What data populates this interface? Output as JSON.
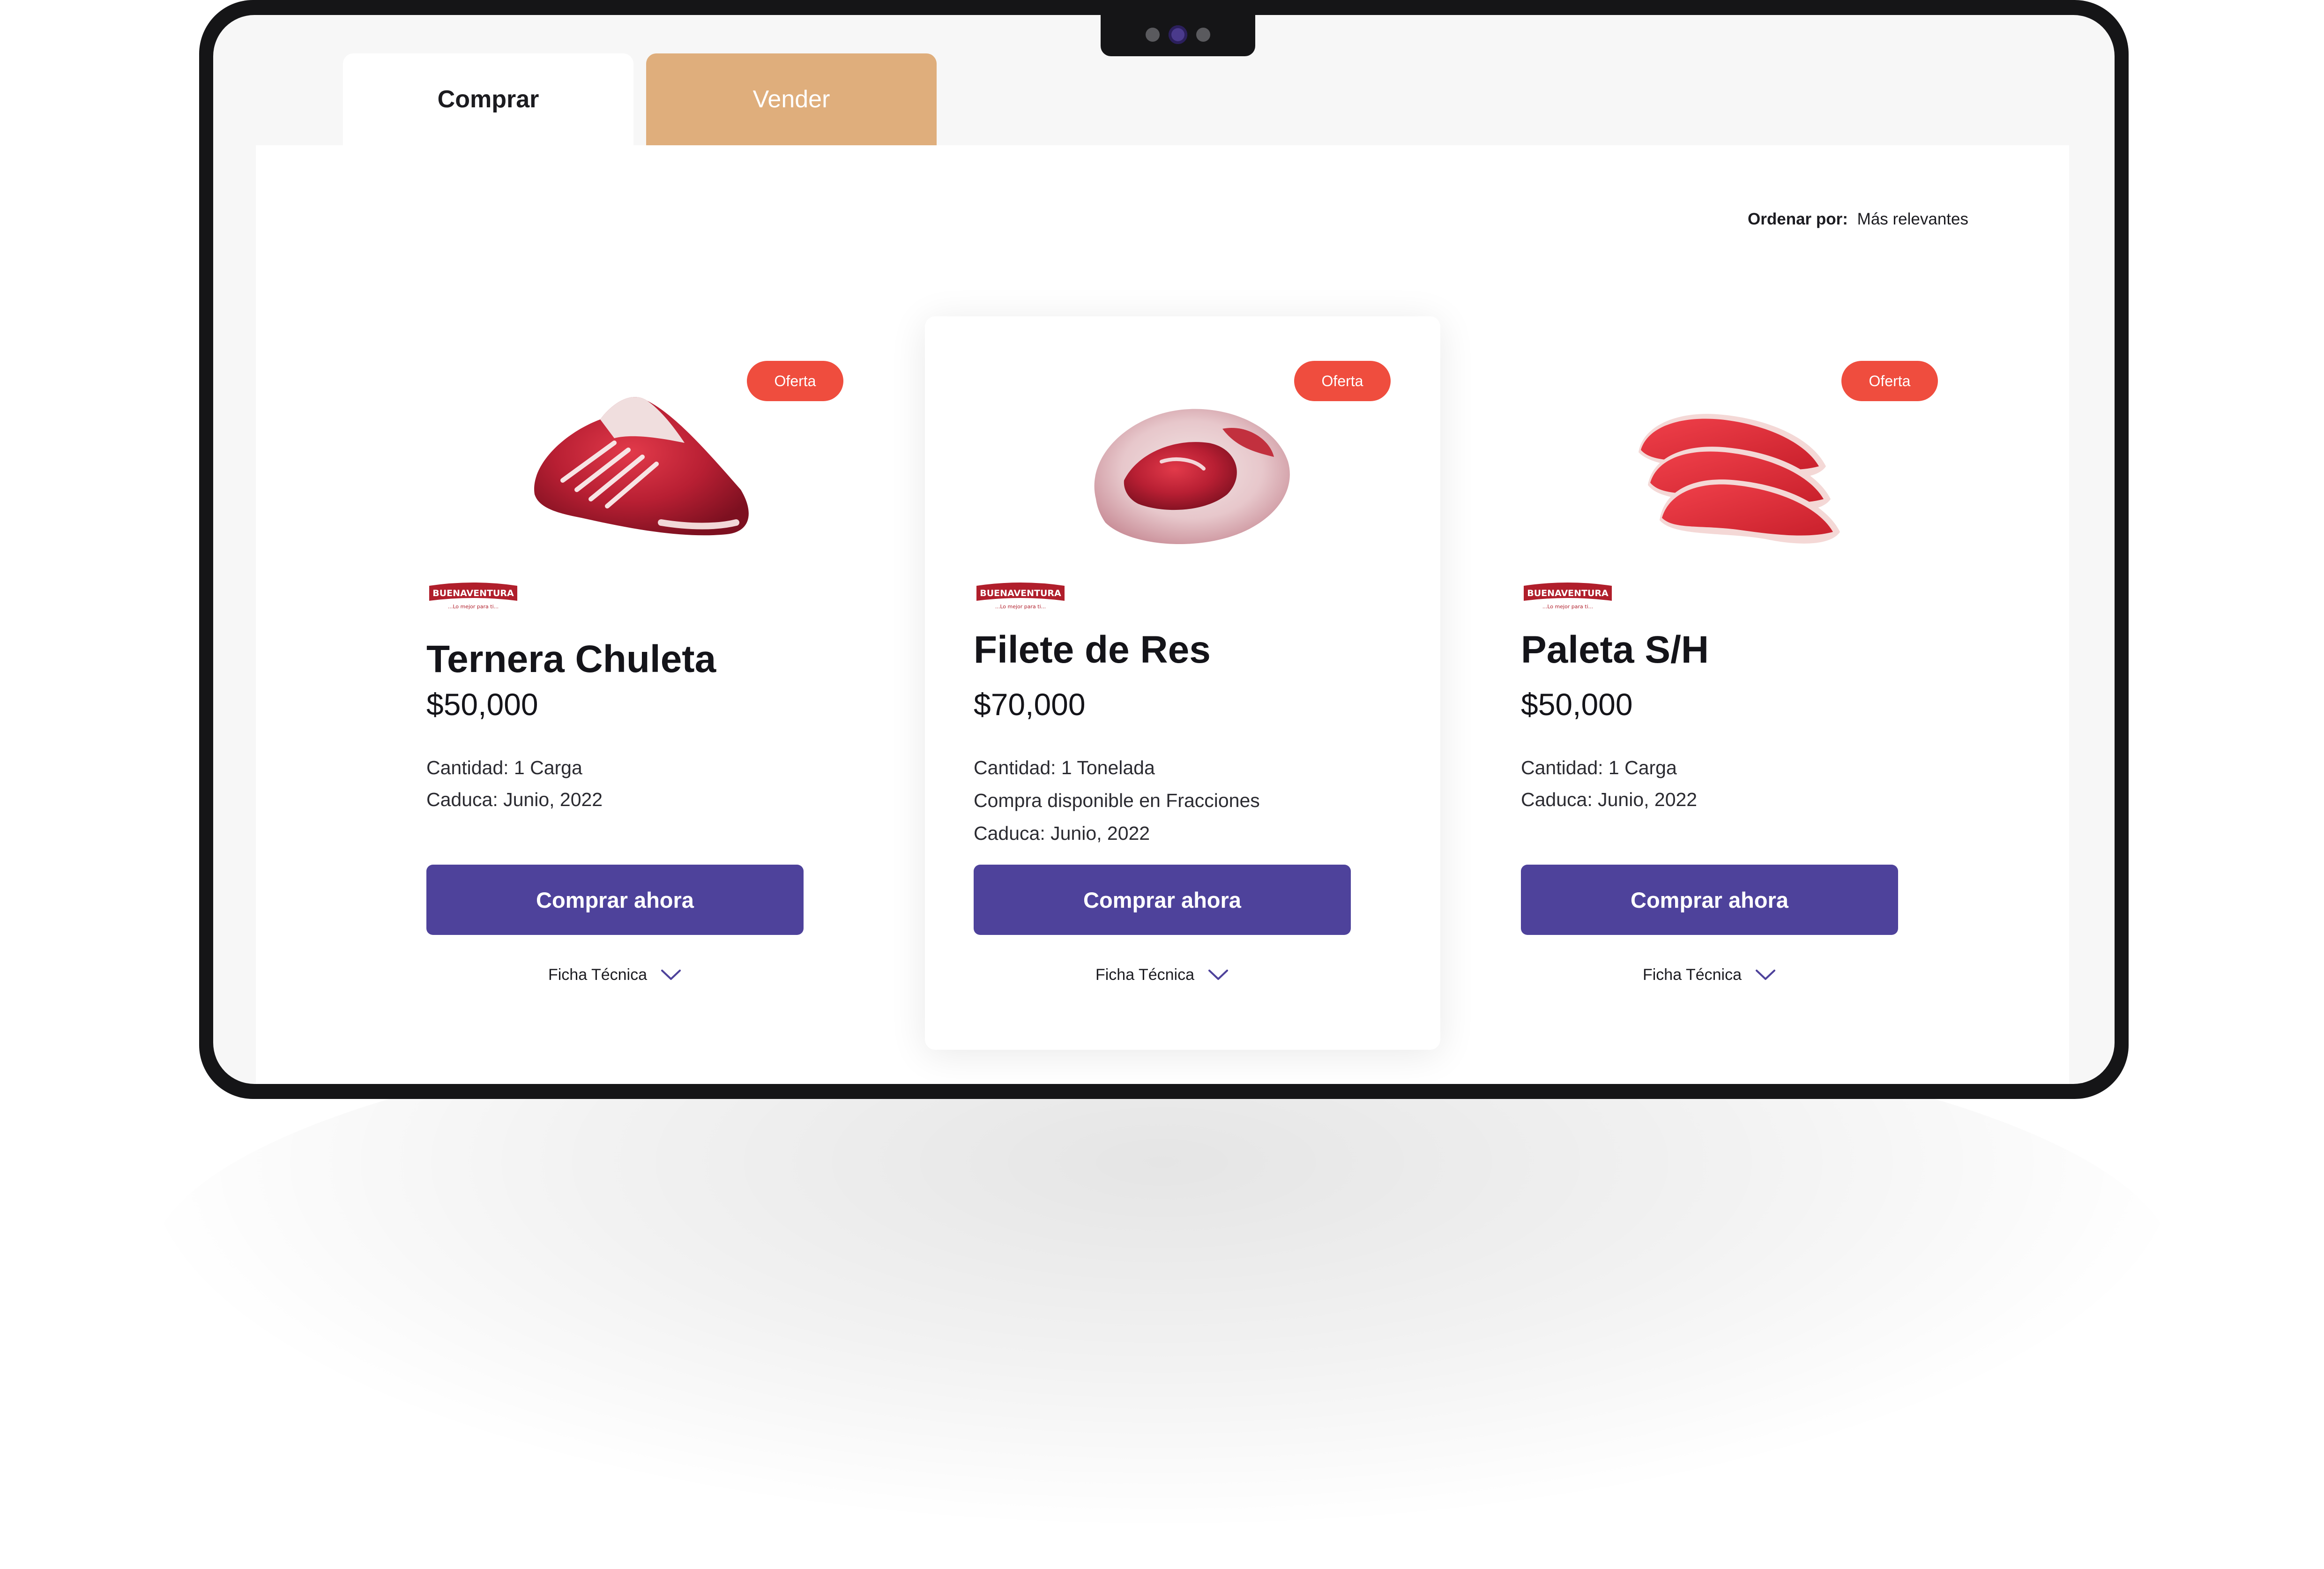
{
  "tabs": [
    {
      "label": "Comprar",
      "active": true
    },
    {
      "label": "Vender",
      "active": false
    }
  ],
  "sort": {
    "label": "Ordenar por:",
    "value": "Más relevantes"
  },
  "colors": {
    "accent": "#4e429b",
    "badge": "#ef4d3e",
    "sell_tab": "#dfae7c",
    "device": "#151517"
  },
  "products": [
    {
      "badge": "Oferta",
      "name": "Ternera Chuleta",
      "price": "$50,000",
      "details": [
        "Cantidad: 1 Carga",
        "Caduca: Junio, 2022"
      ],
      "cta": "Comprar ahora",
      "spec_label": "Ficha Técnica",
      "highlighted": false
    },
    {
      "badge": "Oferta",
      "name": "Filete de Res",
      "price": "$70,000",
      "details": [
        "Cantidad: 1 Tonelada",
        "Compra disponible en Fracciones",
        "Caduca: Junio, 2022"
      ],
      "cta": "Comprar ahora",
      "spec_label": "Ficha Técnica",
      "highlighted": true
    },
    {
      "badge": "Oferta",
      "name": "Paleta S/H",
      "price": "$50,000",
      "details": [
        "Cantidad: 1 Carga",
        "Caduca: Junio, 2022"
      ],
      "cta": "Comprar ahora",
      "spec_label": "Ficha Técnica",
      "highlighted": false
    }
  ],
  "brand": {
    "name": "BUENAVENTURA",
    "tagline": "...Lo mejor para ti..."
  }
}
